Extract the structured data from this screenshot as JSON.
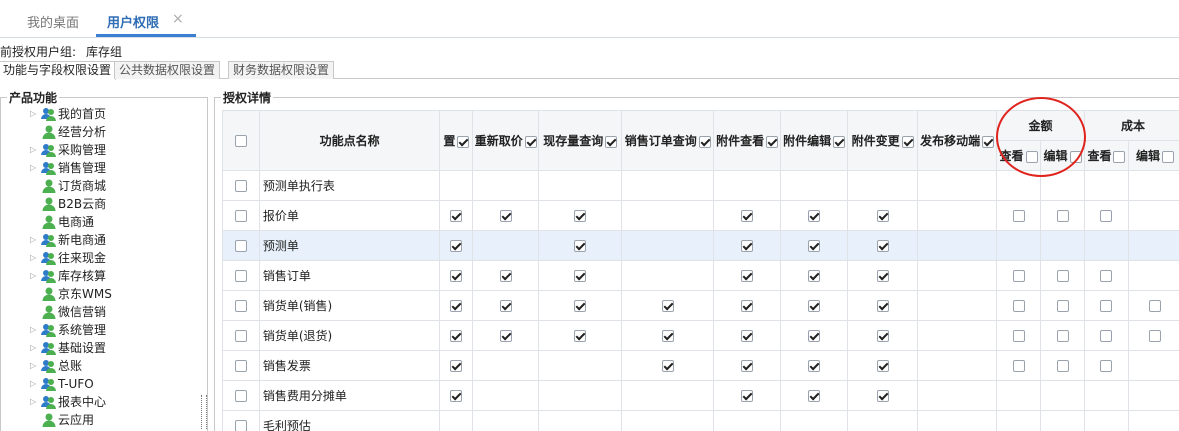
{
  "tabs": {
    "desktop": "我的桌面",
    "permissions": "用户权限",
    "close": "×"
  },
  "current_group": {
    "label": "前授权用户组:",
    "value": "库存组"
  },
  "subtabs": [
    "功能与字段权限设置",
    "公共数据权限设置",
    "财务数据权限设置"
  ],
  "left_panel": {
    "title": "产品功能"
  },
  "tree": [
    {
      "label": "我的首页",
      "has_arrow": true,
      "icon": "group-icon"
    },
    {
      "label": "经营分析",
      "has_arrow": false,
      "icon": "user-icon"
    },
    {
      "label": "采购管理",
      "has_arrow": true,
      "icon": "group-icon"
    },
    {
      "label": "销售管理",
      "has_arrow": true,
      "icon": "group-icon"
    },
    {
      "label": "订货商城",
      "has_arrow": false,
      "icon": "user-icon"
    },
    {
      "label": "B2B云商",
      "has_arrow": false,
      "icon": "user-icon"
    },
    {
      "label": "电商通",
      "has_arrow": false,
      "icon": "user-icon"
    },
    {
      "label": "新电商通",
      "has_arrow": true,
      "icon": "group-icon"
    },
    {
      "label": "往来现金",
      "has_arrow": true,
      "icon": "group-icon"
    },
    {
      "label": "库存核算",
      "has_arrow": true,
      "icon": "group-icon"
    },
    {
      "label": "京东WMS",
      "has_arrow": false,
      "icon": "user-icon"
    },
    {
      "label": "微信营销",
      "has_arrow": false,
      "icon": "user-icon"
    },
    {
      "label": "系统管理",
      "has_arrow": true,
      "icon": "group-icon"
    },
    {
      "label": "基础设置",
      "has_arrow": true,
      "icon": "group-icon"
    },
    {
      "label": "总账",
      "has_arrow": true,
      "icon": "group-icon"
    },
    {
      "label": "T-UFO",
      "has_arrow": true,
      "icon": "group-icon"
    },
    {
      "label": "报表中心",
      "has_arrow": true,
      "icon": "group-icon"
    },
    {
      "label": "云应用",
      "has_arrow": false,
      "icon": "user-icon"
    }
  ],
  "right_panel": {
    "title": "授权详情"
  },
  "table": {
    "name_header": "功能点名称",
    "columns": [
      {
        "label": "置",
        "checked": true
      },
      {
        "label": "重新取价",
        "checked": true
      },
      {
        "label": "现存量查询",
        "checked": true
      },
      {
        "label": "销售订单查询",
        "checked": true
      },
      {
        "label": "附件查看",
        "checked": true
      },
      {
        "label": "附件编辑",
        "checked": true
      },
      {
        "label": "附件变更",
        "checked": true
      },
      {
        "label": "发布移动端",
        "checked": true
      }
    ],
    "groups": [
      {
        "label": "金额",
        "subs": [
          {
            "label": "查看",
            "checked": false
          },
          {
            "label": "编辑",
            "checked": false
          }
        ]
      },
      {
        "label": "成本",
        "subs": [
          {
            "label": "查看",
            "checked": false
          },
          {
            "label": "编辑",
            "checked": false
          }
        ]
      }
    ],
    "rows": [
      {
        "name": "预测单执行表",
        "selected": false,
        "cells": [
          "",
          "",
          "",
          "",
          "",
          "",
          "",
          "",
          "",
          "",
          "",
          ""
        ]
      },
      {
        "name": "报价单",
        "selected": false,
        "cells": [
          "on",
          "on",
          "on",
          "",
          "on",
          "on",
          "on",
          "",
          "off",
          "off",
          "off",
          ""
        ]
      },
      {
        "name": "预测单",
        "selected": true,
        "cells": [
          "on",
          "",
          "on",
          "",
          "on",
          "on",
          "on",
          "",
          "",
          "",
          "",
          ""
        ]
      },
      {
        "name": "销售订单",
        "selected": false,
        "cells": [
          "on",
          "on",
          "on",
          "",
          "on",
          "on",
          "on",
          "",
          "off",
          "off",
          "off",
          ""
        ]
      },
      {
        "name": "销货单(销售)",
        "selected": false,
        "cells": [
          "on",
          "on",
          "on",
          "on",
          "on",
          "on",
          "on",
          "",
          "off",
          "off",
          "off",
          "off"
        ]
      },
      {
        "name": "销货单(退货)",
        "selected": false,
        "cells": [
          "on",
          "on",
          "on",
          "on",
          "on",
          "on",
          "on",
          "",
          "off",
          "off",
          "off",
          "off"
        ]
      },
      {
        "name": "销售发票",
        "selected": false,
        "cells": [
          "on",
          "",
          "",
          "on",
          "on",
          "on",
          "on",
          "",
          "off",
          "off",
          "off",
          ""
        ]
      },
      {
        "name": "销售费用分摊单",
        "selected": false,
        "cells": [
          "on",
          "",
          "",
          "",
          "on",
          "on",
          "on",
          "",
          "",
          "",
          "",
          ""
        ]
      },
      {
        "name": "毛利预估",
        "selected": false,
        "cells": [
          "",
          "",
          "",
          "",
          "",
          "",
          "",
          "",
          "",
          "",
          "",
          ""
        ]
      }
    ]
  },
  "colors": {
    "accent": "#3b7fd0",
    "highlight_row": "#e8f1fb",
    "annotation": "#e0231c"
  }
}
